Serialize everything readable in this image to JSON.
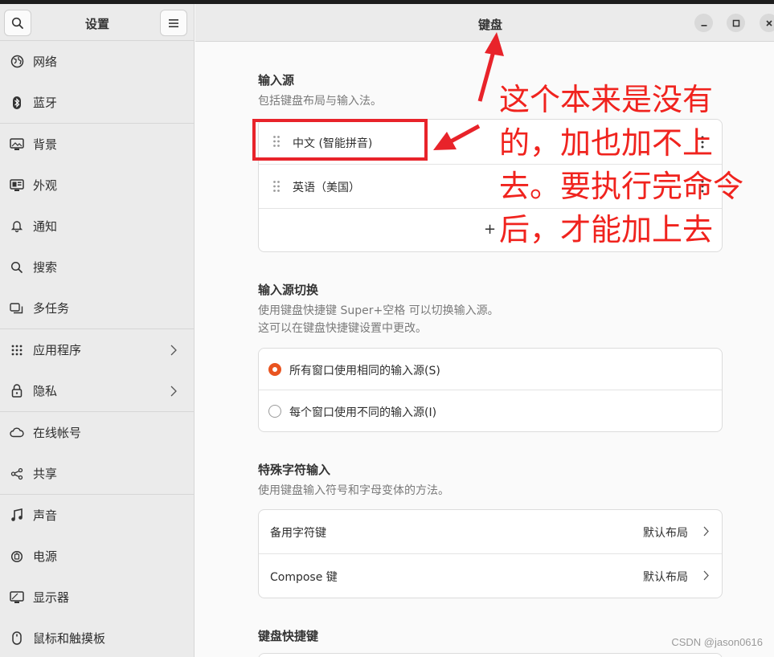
{
  "sidebar": {
    "title": "设置",
    "items": [
      {
        "label": "网络",
        "icon": "network-icon"
      },
      {
        "label": "蓝牙",
        "icon": "bluetooth-icon"
      },
      {
        "label": "背景",
        "icon": "background-icon"
      },
      {
        "label": "外观",
        "icon": "appearance-icon"
      },
      {
        "label": "通知",
        "icon": "bell-icon"
      },
      {
        "label": "搜索",
        "icon": "search-icon"
      },
      {
        "label": "多任务",
        "icon": "multitask-icon"
      },
      {
        "label": "应用程序",
        "icon": "apps-grid-icon"
      },
      {
        "label": "隐私",
        "icon": "lock-icon"
      },
      {
        "label": "在线帐号",
        "icon": "cloud-icon"
      },
      {
        "label": "共享",
        "icon": "share-icon"
      },
      {
        "label": "声音",
        "icon": "music-note-icon"
      },
      {
        "label": "电源",
        "icon": "power-icon"
      },
      {
        "label": "显示器",
        "icon": "display-icon"
      },
      {
        "label": "鼠标和触摸板",
        "icon": "mouse-icon"
      }
    ]
  },
  "header": {
    "title": "键盘"
  },
  "input_sources": {
    "title": "输入源",
    "desc": "包括键盘布局与输入法。",
    "items": [
      "中文 (智能拼音)",
      "英语（美国）"
    ],
    "add_symbol": "+"
  },
  "switching": {
    "title": "输入源切换",
    "desc_line1": "使用键盘快捷键 Super+空格 可以切换输入源。",
    "desc_line2": "这可以在键盘快捷键设置中更改。",
    "options": [
      {
        "label": "所有窗口使用相同的输入源(S)",
        "selected": true
      },
      {
        "label": "每个窗口使用不同的输入源(I)",
        "selected": false
      }
    ]
  },
  "special_chars": {
    "title": "特殊字符输入",
    "desc": "使用键盘输入符号和字母变体的方法。",
    "rows": [
      {
        "label": "备用字符键",
        "value": "默认布局"
      },
      {
        "label": "Compose 键",
        "value": "默认布局"
      }
    ]
  },
  "shortcuts": {
    "title": "键盘快捷键"
  },
  "annotation": {
    "text": "这个本来是没有的，加也加不上去。要执行完命令后，才能加上去"
  },
  "watermark": "CSDN @jason0616",
  "colors": {
    "accent": "#e95420",
    "annotation_red": "#e8232a"
  }
}
